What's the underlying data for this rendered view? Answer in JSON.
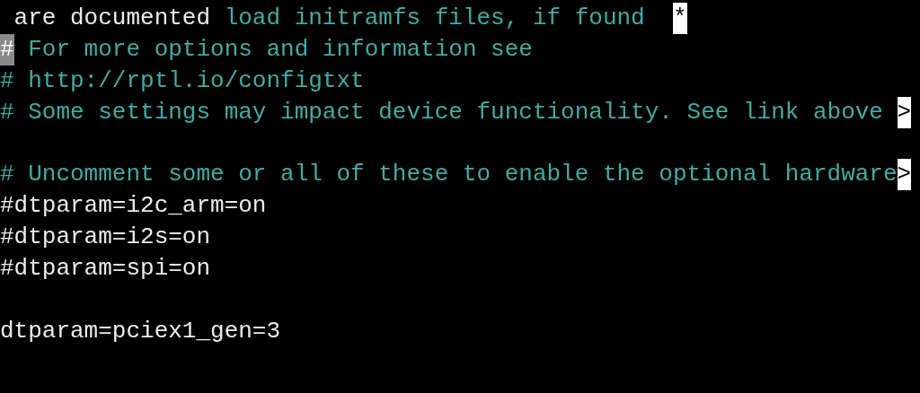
{
  "lines": [
    {
      "kind": "text",
      "segments": [
        {
          "kind": "plain",
          "text": " are documented"
        },
        {
          "kind": "comment",
          "text": " load initramfs files, if found  "
        },
        {
          "kind": "marker",
          "text": "*"
        }
      ]
    },
    {
      "kind": "text",
      "segments": [
        {
          "kind": "cursor",
          "text": "#"
        },
        {
          "kind": "comment",
          "text": " For more options and information see"
        }
      ]
    },
    {
      "kind": "text",
      "segments": [
        {
          "kind": "comment",
          "text": "# http://rptl.io/configtxt"
        }
      ]
    },
    {
      "kind": "text",
      "segments": [
        {
          "kind": "comment",
          "text": "# Some settings may impact device functionality. See link above "
        },
        {
          "kind": "marker",
          "text": ">"
        }
      ]
    },
    {
      "kind": "blank"
    },
    {
      "kind": "text",
      "segments": [
        {
          "kind": "comment",
          "text": "# Uncomment some or all of these to enable the optional hardware"
        },
        {
          "kind": "marker",
          "text": ">"
        }
      ]
    },
    {
      "kind": "text",
      "segments": [
        {
          "kind": "plain",
          "text": "#dtparam=i2c_arm=on"
        }
      ]
    },
    {
      "kind": "text",
      "segments": [
        {
          "kind": "plain",
          "text": "#dtparam=i2s=on"
        }
      ]
    },
    {
      "kind": "text",
      "segments": [
        {
          "kind": "plain",
          "text": "#dtparam=spi=on"
        }
      ]
    },
    {
      "kind": "blank"
    },
    {
      "kind": "text",
      "segments": [
        {
          "kind": "plain",
          "text": "dtparam=pciex1_gen=3"
        }
      ]
    }
  ]
}
